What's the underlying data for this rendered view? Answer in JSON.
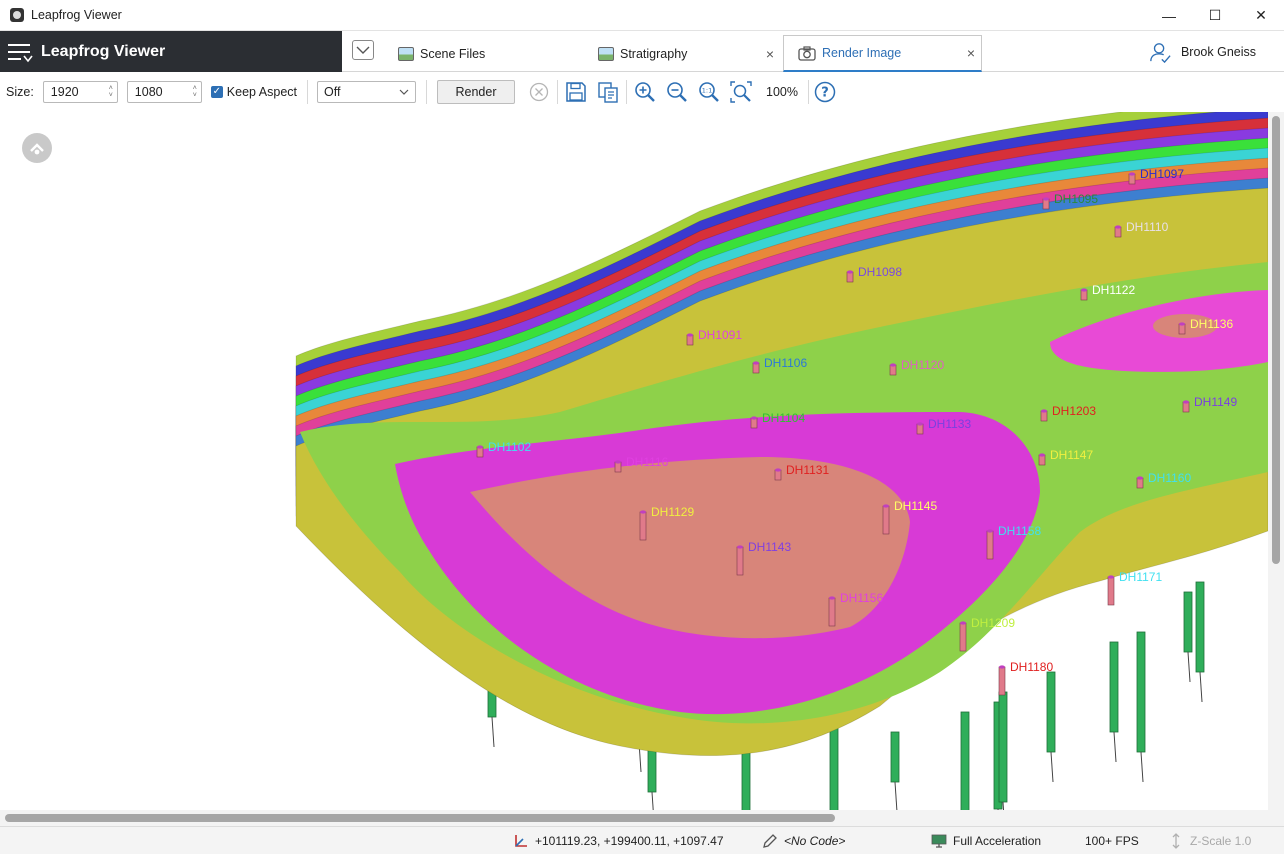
{
  "window": {
    "title": "Leapfrog Viewer"
  },
  "app": {
    "brand": "Leapfrog Viewer"
  },
  "tabs": [
    {
      "label": "Scene Files",
      "active": false,
      "closable": false
    },
    {
      "label": "Stratigraphy",
      "active": false,
      "closable": true
    },
    {
      "label": "Render Image",
      "active": true,
      "closable": true
    }
  ],
  "user": {
    "name": "Brook Gneiss"
  },
  "toolbar": {
    "size_label": "Size:",
    "width": "1920",
    "height": "1080",
    "keep_aspect_label": "Keep Aspect",
    "keep_aspect_checked": true,
    "mode": "Off",
    "render_label": "Render",
    "zoom": "100%"
  },
  "drillholes": [
    {
      "id": "DH1097",
      "color": "#2b2bd0"
    },
    {
      "id": "DH1095",
      "color": "#2a8a3a"
    },
    {
      "id": "DH1110",
      "color": "#e8e0e8"
    },
    {
      "id": "DH1098",
      "color": "#7a4ae0"
    },
    {
      "id": "DH1122",
      "color": "#ffffff"
    },
    {
      "id": "DH1136",
      "color": "#ffff66"
    },
    {
      "id": "DH1091",
      "color": "#e040e0"
    },
    {
      "id": "DH1106",
      "color": "#2b7ad6"
    },
    {
      "id": "DH1120",
      "color": "#e060c0"
    },
    {
      "id": "DH1149",
      "color": "#7a40e0"
    },
    {
      "id": "DH1203",
      "color": "#e02020"
    },
    {
      "id": "DH1133",
      "color": "#7a40e0"
    },
    {
      "id": "DH1104",
      "color": "#30c030"
    },
    {
      "id": "DH1102",
      "color": "#40e0f0"
    },
    {
      "id": "DH1116",
      "color": "#e040e0"
    },
    {
      "id": "DH1131",
      "color": "#e02020"
    },
    {
      "id": "DH1147",
      "color": "#f0f040"
    },
    {
      "id": "DH1160",
      "color": "#40e0f0"
    },
    {
      "id": "DH1129",
      "color": "#f0f040"
    },
    {
      "id": "DH1145",
      "color": "#ffff66"
    },
    {
      "id": "DH1158",
      "color": "#40e0f0"
    },
    {
      "id": "DH1143",
      "color": "#8040e0"
    },
    {
      "id": "DH1171",
      "color": "#40e0f0"
    },
    {
      "id": "DH1156",
      "color": "#e040e0"
    },
    {
      "id": "DH1209",
      "color": "#c0f040"
    },
    {
      "id": "DH1180",
      "color": "#e02020"
    }
  ],
  "status": {
    "coords": "+101119.23, +199400.11, +1097.47",
    "code": "<No Code>",
    "acceleration": "Full Acceleration",
    "fps": "100+ FPS",
    "zscale": "Z-Scale 1.0"
  }
}
